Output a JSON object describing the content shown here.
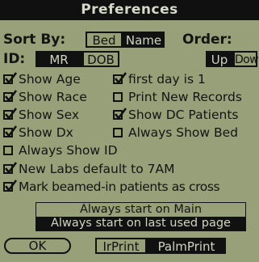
{
  "title": "Preferences",
  "sort": {
    "label": "Sort By:",
    "options": [
      "Bed",
      "Name"
    ],
    "selected": "Name"
  },
  "order": {
    "label": "Order:",
    "options": [
      "Up",
      "Down"
    ],
    "selected": "Up"
  },
  "id": {
    "label": "ID:",
    "options": [
      "MR",
      "DOB"
    ],
    "selected": "MR"
  },
  "checkboxes": [
    {
      "label": "Show Age",
      "checked": true
    },
    {
      "label": "first day is 1",
      "checked": true
    },
    {
      "label": "Show Race",
      "checked": true
    },
    {
      "label": "Print New Records",
      "checked": false
    },
    {
      "label": "Show Sex",
      "checked": true
    },
    {
      "label": "Show DC Patients",
      "checked": true
    },
    {
      "label": "Show Dx",
      "checked": true
    },
    {
      "label": "Always Show Bed",
      "checked": false
    },
    {
      "label": "Always Show ID",
      "checked": false
    },
    {
      "label": "New Labs default to 7AM",
      "checked": true
    },
    {
      "label": "Mark beamed-in patients as cross",
      "checked": true
    }
  ],
  "startup_list": {
    "items": [
      "Always start on Main",
      "Always start on last used page"
    ],
    "selected_index": 1
  },
  "buttons": {
    "ok": "OK",
    "print_options": [
      "IrPrint",
      "PalmPrint"
    ],
    "print_selected": "PalmPrint"
  },
  "colors": {
    "screen_bg": "#97a078",
    "ink": "#111111",
    "inverse_text": "#cfd5bf"
  }
}
